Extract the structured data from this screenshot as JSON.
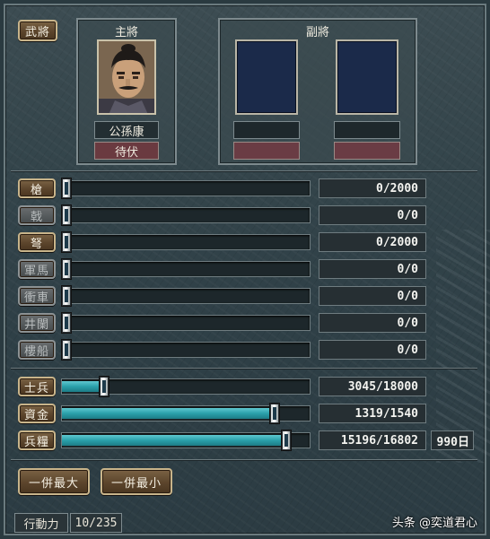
{
  "officers": {
    "button": "武將",
    "main_title": "主將",
    "main_name": "公孫康",
    "main_status": "待伏",
    "vice_title": "副將"
  },
  "resources": [
    {
      "label": "槍",
      "value": "0/2000",
      "enabled": true,
      "fill": 0.0
    },
    {
      "label": "戟",
      "value": "0/0",
      "enabled": false,
      "fill": 0.0
    },
    {
      "label": "弩",
      "value": "0/2000",
      "enabled": true,
      "fill": 0.0
    },
    {
      "label": "軍馬",
      "value": "0/0",
      "enabled": false,
      "fill": 0.0
    },
    {
      "label": "衝車",
      "value": "0/0",
      "enabled": false,
      "fill": 0.0
    },
    {
      "label": "井闌",
      "value": "0/0",
      "enabled": false,
      "fill": 0.0
    },
    {
      "label": "樓船",
      "value": "0/0",
      "enabled": false,
      "fill": 0.0
    }
  ],
  "supplies": [
    {
      "label": "士兵",
      "value": "3045/18000",
      "fill": 0.169
    },
    {
      "label": "資金",
      "value": "1319/1540",
      "fill": 0.857
    },
    {
      "label": "兵糧",
      "value": "15196/16802",
      "fill": 0.904
    }
  ],
  "food_days": "990日",
  "actions": {
    "max": "一併最大",
    "min": "一併最小"
  },
  "footer": {
    "label": "行動力",
    "value": "10/235"
  },
  "watermark": "头条 @奕道君心",
  "colors": {
    "bar_fill": "#2aa0aa",
    "button": "#5c452c",
    "status_red": "#6a3a40"
  }
}
